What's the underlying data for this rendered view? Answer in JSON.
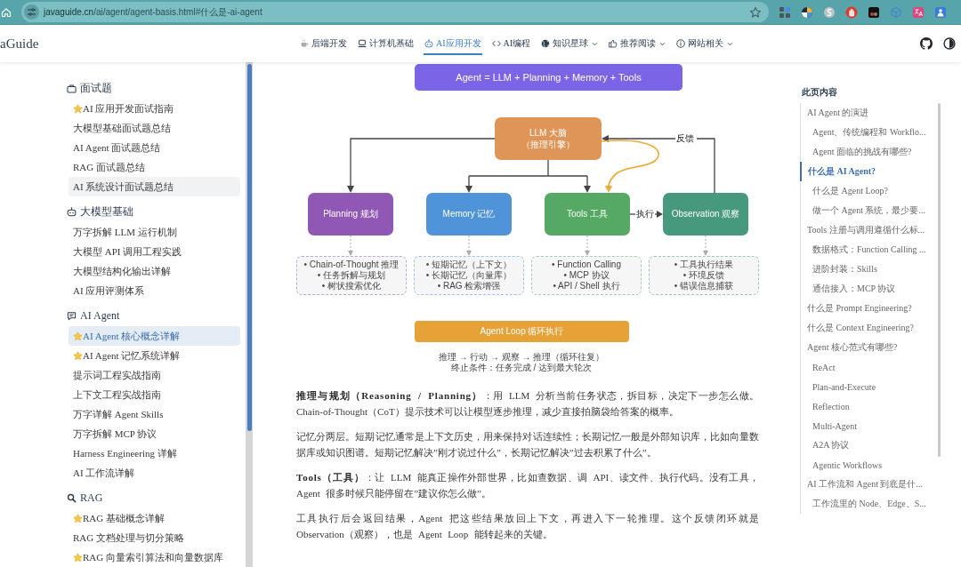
{
  "browser": {
    "url_host": "javaguide.cn",
    "url_path": "/ai/agent/agent-basis.html#什么是-ai-agent"
  },
  "header": {
    "logo": "aGuide",
    "nav": [
      {
        "label": "后端开发",
        "selected": false,
        "dropdown": false
      },
      {
        "label": "计算机基础",
        "selected": false,
        "dropdown": false
      },
      {
        "label": "AI应用开发",
        "selected": true,
        "dropdown": false
      },
      {
        "label": "AI编程",
        "selected": false,
        "dropdown": false
      },
      {
        "label": "知识星球",
        "selected": false,
        "dropdown": true
      },
      {
        "label": "推荐阅读",
        "selected": false,
        "dropdown": true
      },
      {
        "label": "网站相关",
        "selected": false,
        "dropdown": true
      }
    ]
  },
  "sidebar": {
    "sections": [
      {
        "title": "面试题",
        "items": [
          {
            "label": "AI 应用开发面试指南",
            "starred": true,
            "selected": false,
            "hovered": false
          },
          {
            "label": "大模型基础面试题总结",
            "starred": false,
            "selected": false,
            "hovered": false
          },
          {
            "label": "AI Agent 面试题总结",
            "starred": false,
            "selected": false,
            "hovered": false
          },
          {
            "label": "RAG 面试题总结",
            "starred": false,
            "selected": false,
            "hovered": false
          },
          {
            "label": "AI 系统设计面试题总结",
            "starred": false,
            "selected": false,
            "hovered": true
          }
        ]
      },
      {
        "title": "大模型基础",
        "items": [
          {
            "label": "万字拆解 LLM 运行机制",
            "starred": false,
            "selected": false,
            "hovered": false
          },
          {
            "label": "大模型 API 调用工程实践",
            "starred": false,
            "selected": false,
            "hovered": false
          },
          {
            "label": "大模型结构化输出详解",
            "starred": false,
            "selected": false,
            "hovered": false
          },
          {
            "label": "AI 应用评测体系",
            "starred": false,
            "selected": false,
            "hovered": false
          }
        ]
      },
      {
        "title": "AI Agent",
        "items": [
          {
            "label": "AI Agent 核心概念详解",
            "starred": true,
            "selected": true,
            "hovered": false
          },
          {
            "label": "AI Agent 记忆系统详解",
            "starred": true,
            "selected": false,
            "hovered": false
          },
          {
            "label": "提示词工程实战指南",
            "starred": false,
            "selected": false,
            "hovered": false
          },
          {
            "label": "上下文工程实战指南",
            "starred": false,
            "selected": false,
            "hovered": false
          },
          {
            "label": "万字详解 Agent Skills",
            "starred": false,
            "selected": false,
            "hovered": false
          },
          {
            "label": "万字拆解 MCP 协议",
            "starred": false,
            "selected": false,
            "hovered": false
          },
          {
            "label": "Harness Engineering 详解",
            "starred": false,
            "selected": false,
            "hovered": false
          },
          {
            "label": "AI 工作流详解",
            "starred": false,
            "selected": false,
            "hovered": false
          }
        ]
      },
      {
        "title": "RAG",
        "items": [
          {
            "label": "RAG 基础概念详解",
            "starred": true,
            "selected": false,
            "hovered": false
          },
          {
            "label": "RAG 文档处理与切分策略",
            "starred": false,
            "selected": false,
            "hovered": false
          },
          {
            "label": "RAG 向量索引算法和向量数据库",
            "starred": true,
            "selected": false,
            "hovered": false
          }
        ]
      }
    ]
  },
  "article": {
    "figure": {
      "title": "Agent = LLM + Planning + Memory + Tools",
      "core": {
        "label": "LLM 大脑",
        "sublabel": "（推理引擎）"
      },
      "modules": [
        {
          "label": "Planning 规划",
          "color": "#9057b5",
          "details": [
            "• Chain-of-Thought 推理",
            "• 任务拆解与规划",
            "• 树状搜索优化"
          ]
        },
        {
          "label": "Memory 记忆",
          "color": "#4f93d8",
          "details": [
            "• 短期记忆（上下文）",
            "• 长期记忆（向量库）",
            "• RAG 检索增强"
          ]
        },
        {
          "label": "Tools 工具",
          "color": "#55a965",
          "details": [
            "• Function Calling",
            "• MCP 协议",
            "• API / Shell 执行"
          ]
        },
        {
          "label": "Observation 观察",
          "color": "#46997c",
          "details": [
            "• 工具执行结果",
            "• 环境反馈",
            "• 错误信息捕获"
          ]
        }
      ],
      "execute_label": "执行",
      "feedback_label": "反馈",
      "loop": "Agent Loop 循环执行",
      "caption": [
        "推理 → 行动 → 观察 → 推理（循环往复）",
        "终止条件：任务完成 / 达到最大轮次"
      ]
    },
    "paragraphs": [
      "**推理与规划（Reasoning / Planning）**：用 LLM 分析当前任务状态，拆目标，决定下一步怎么做。Chain-of-Thought（CoT）提示技术可以让模型逐步推理，减少直接拍脑袋给答案的概率。",
      "记忆分两层。短期记忆通常是上下文历史，用来保持对话连续性；长期记忆一般是外部知识库，比如向量数据库或知识图谱。短期记忆解决”刚才说过什么”，长期记忆解决”过去积累了什么”。",
      "**Tools（工具）**：让 LLM 能真正操作外部世界，比如查数据、调 API、读文件、执行代码。没有工具，Agent 很多时候只能停留在”建议你怎么做”。",
      "工具执行后会返回结果，Agent 把这些结果放回上下文，再进入下一轮推理。这个反馈闭环就是 Observation（观察），也是 Agent Loop 能转起来的关键。"
    ]
  },
  "toc": {
    "title": "此页内容",
    "items": [
      {
        "label": "AI Agent 的演进",
        "selected": false,
        "children": [
          {
            "label": "Agent、传统编程和 Workflo...",
            "selected": false
          },
          {
            "label": "Agent 面临的挑战有哪些?",
            "selected": false
          }
        ]
      },
      {
        "label": "什么是 AI Agent?",
        "selected": true,
        "children": [
          {
            "label": "什么是 Agent Loop?",
            "selected": false
          },
          {
            "label": "做一个 Agent 系统，最少要...",
            "selected": false
          }
        ]
      },
      {
        "label": "Tools 注册与调用遵循什么标...",
        "selected": false,
        "children": [
          {
            "label": "数据格式：Function Calling ...",
            "selected": false
          },
          {
            "label": "进阶封装：Skills",
            "selected": false
          },
          {
            "label": "通信接入：MCP 协议",
            "selected": false
          }
        ]
      },
      {
        "label": "什么是 Prompt Engineering?",
        "selected": false
      },
      {
        "label": "什么是 Context Engineering?",
        "selected": false
      },
      {
        "label": "Agent 核心范式有哪些?",
        "selected": false,
        "children": [
          {
            "label": "ReAct",
            "selected": false
          },
          {
            "label": "Plan-and-Execute",
            "selected": false
          },
          {
            "label": "Reflection",
            "selected": false
          },
          {
            "label": "Multi-Agent",
            "selected": false
          },
          {
            "label": "A2A 协议",
            "selected": false
          },
          {
            "label": "Agentic Workflows",
            "selected": false
          }
        ]
      },
      {
        "label": "AI 工作流和 Agent 到底是什...",
        "selected": false,
        "children": [
          {
            "label": "工作流里的 Node、Edge、S...",
            "selected": false
          }
        ]
      }
    ]
  }
}
